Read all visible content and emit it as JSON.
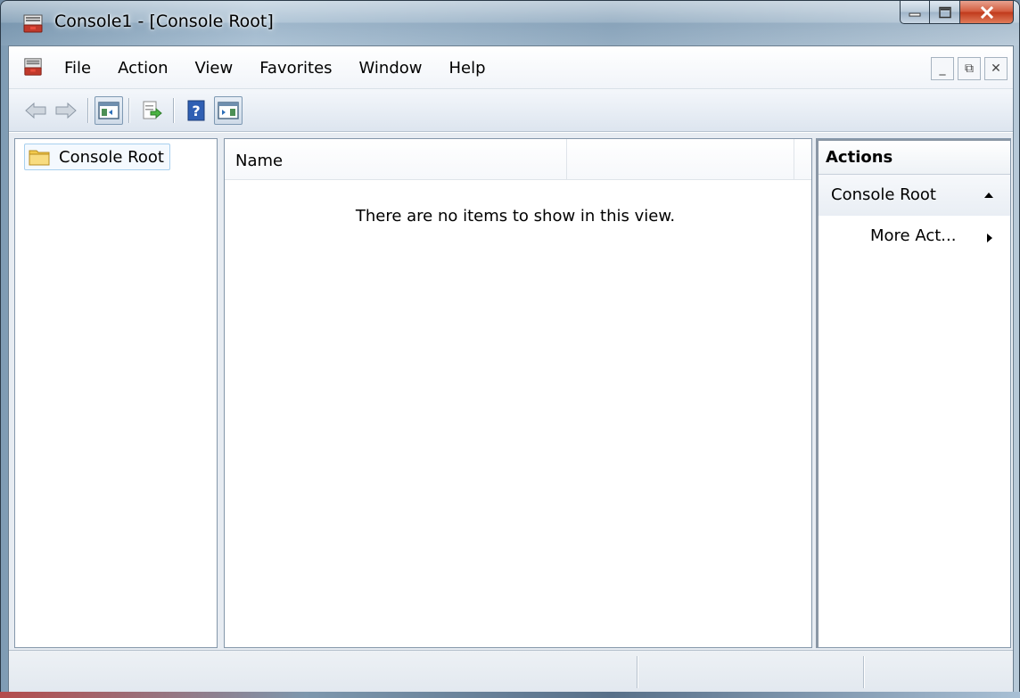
{
  "window": {
    "title": "Console1 - [Console Root]",
    "icon": "mmc-console-icon"
  },
  "caption_buttons": {
    "minimize_icon": "minimize-icon",
    "maximize_icon": "maximize-icon",
    "close_icon": "close-icon"
  },
  "menubar": {
    "items": [
      {
        "label": "File"
      },
      {
        "label": "Action"
      },
      {
        "label": "View"
      },
      {
        "label": "Favorites"
      },
      {
        "label": "Window"
      },
      {
        "label": "Help"
      }
    ]
  },
  "mdi": {
    "minimize": "_",
    "restore": "⧉",
    "close": "✕"
  },
  "toolbar": {
    "buttons": [
      "back-icon",
      "forward-icon",
      "show-hide-console-tree-icon",
      "export-list-icon",
      "help-icon",
      "show-hide-action-pane-icon"
    ]
  },
  "tree": {
    "root_label": "Console Root"
  },
  "list": {
    "column_name": "Name",
    "empty_message": "There are no items to show in this view."
  },
  "actions": {
    "title": "Actions",
    "group_label": "Console Root",
    "link_label": "More Act..."
  },
  "colors": {
    "accent_folder": "#f2c94c",
    "close_button": "#c0391b"
  }
}
